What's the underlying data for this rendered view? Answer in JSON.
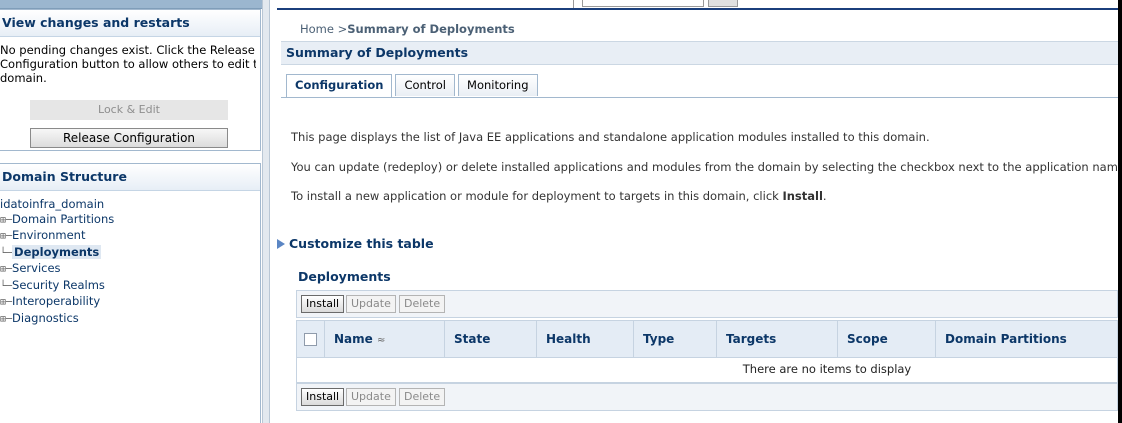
{
  "change_center": {
    "header": "View changes and restarts",
    "message_lines": [
      "No pending changes exist. Click the Release",
      "Configuration button to allow others to edit the",
      "domain."
    ],
    "lock_edit_label": "Lock & Edit",
    "release_config_label": "Release Configuration"
  },
  "domain_structure": {
    "header": "Domain Structure",
    "root": "idatoinfra_domain",
    "items": [
      {
        "label": "Domain Partitions",
        "prefix": "⊞─"
      },
      {
        "label": "Environment",
        "prefix": "⊞─"
      },
      {
        "label": "Deployments",
        "prefix": "└─",
        "selected": true
      },
      {
        "label": "Services",
        "prefix": "⊞─"
      },
      {
        "label": "Security Realms",
        "prefix": "└─"
      },
      {
        "label": "Interoperability",
        "prefix": "⊞─"
      },
      {
        "label": "Diagnostics",
        "prefix": "⊞─"
      }
    ]
  },
  "breadcrumb": {
    "home": "Home",
    "separator": " >",
    "current": "Summary of Deployments"
  },
  "page_title": "Summary of Deployments",
  "tabs": [
    {
      "label": "Configuration",
      "active": true
    },
    {
      "label": "Control",
      "active": false
    },
    {
      "label": "Monitoring",
      "active": false
    }
  ],
  "description": {
    "line1": "This page displays the list of Java EE applications and standalone application modules installed to this domain.",
    "line2": "You can update (redeploy) or delete installed applications and modules from the domain by selecting the checkbox next to the application name and then",
    "line3_prefix": "To install a new application or module for deployment to targets in this domain, click ",
    "line3_bold": "Install",
    "line3_suffix": "."
  },
  "customize_label": "Customize this table",
  "deployments_label": "Deployments",
  "toolbar": {
    "install": "Install",
    "update": "Update",
    "delete": "Delete"
  },
  "table": {
    "columns": [
      "Name",
      "State",
      "Health",
      "Type",
      "Targets",
      "Scope",
      "Domain Partitions"
    ],
    "sort_icon": "≈",
    "empty_message": "There are no items to display"
  },
  "colors": {
    "header_text": "#0c3768",
    "accent_bar": "#1b3f7c",
    "table_header_bg": "#e4ecf5"
  }
}
